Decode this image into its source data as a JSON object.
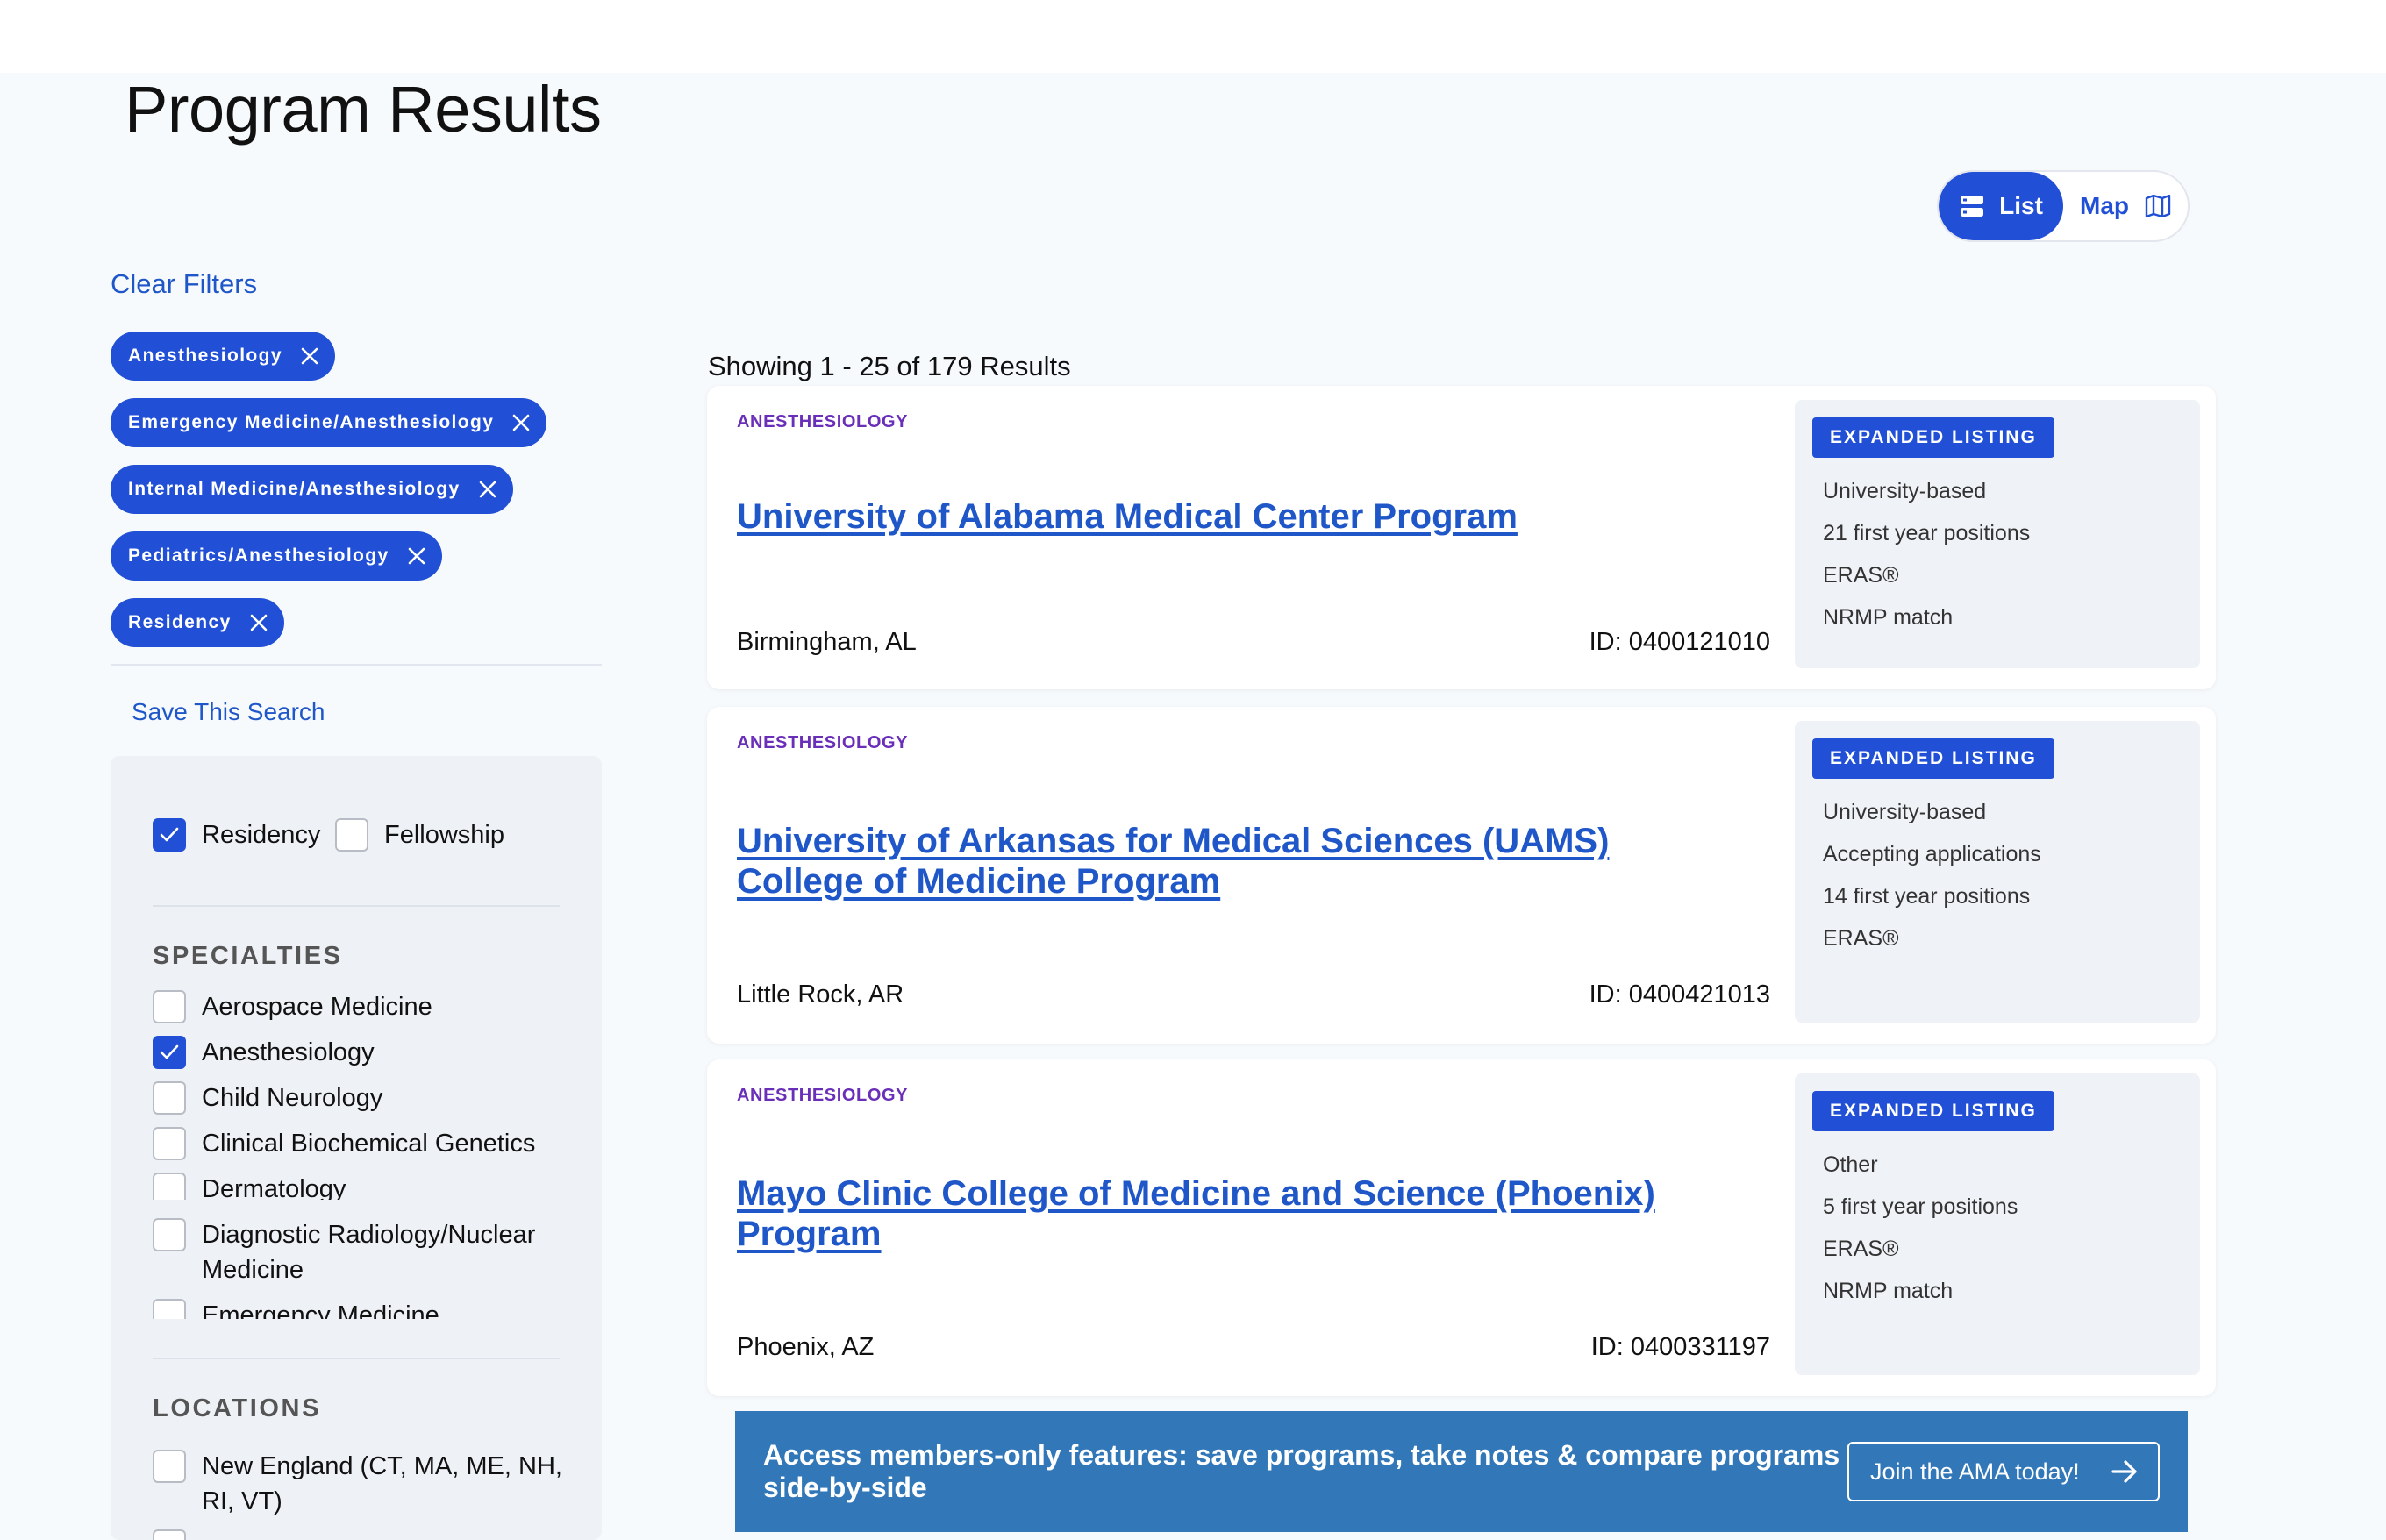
{
  "page": {
    "title": "Program Results"
  },
  "view_toggle": {
    "list_label": "List",
    "map_label": "Map"
  },
  "filters": {
    "clear_label": "Clear Filters",
    "chips": [
      {
        "label": "Anesthesiology"
      },
      {
        "label": "Emergency Medicine/Anesthesiology"
      },
      {
        "label": "Internal Medicine/Anesthesiology"
      },
      {
        "label": "Pediatrics/Anesthesiology"
      },
      {
        "label": "Residency"
      }
    ],
    "save_label": "Save This Search",
    "program_types": [
      {
        "label": "Residency",
        "checked": true
      },
      {
        "label": "Fellowship",
        "checked": false
      }
    ],
    "specialties_title": "SPECIALTIES",
    "specialties": [
      {
        "label": "Aerospace Medicine",
        "checked": false
      },
      {
        "label": "Anesthesiology",
        "checked": true
      },
      {
        "label": "Child Neurology",
        "checked": false
      },
      {
        "label": "Clinical Biochemical Genetics",
        "checked": false
      },
      {
        "label": "Dermatology",
        "checked": false
      },
      {
        "label": "Diagnostic Radiology/Nuclear Medicine",
        "checked": false
      },
      {
        "label": "Emergency Medicine",
        "checked": false
      }
    ],
    "locations_title": "LOCATIONS",
    "locations": [
      {
        "label": "New England (CT, MA, ME, NH, RI, VT)",
        "checked": false
      }
    ]
  },
  "results": {
    "count_text": "Showing 1 - 25 of 179 Results",
    "items": [
      {
        "specialty": "ANESTHESIOLOGY",
        "title": "University of Alabama Medical Center Program",
        "location": "Birmingham, AL",
        "id_text": "ID: 0400121010",
        "badge": "EXPANDED LISTING",
        "features": [
          "University-based",
          "21 first year positions",
          "ERAS®",
          "NRMP match"
        ]
      },
      {
        "specialty": "ANESTHESIOLOGY",
        "title": "University of Arkansas for Medical Sciences (UAMS) College of Medicine Program",
        "location": "Little Rock, AR",
        "id_text": "ID: 0400421013",
        "badge": "EXPANDED LISTING",
        "features": [
          "University-based",
          "Accepting applications",
          "14 first year positions",
          "ERAS®"
        ]
      },
      {
        "specialty": "ANESTHESIOLOGY",
        "title": "Mayo Clinic College of Medicine and Science (Phoenix) Program",
        "location": "Phoenix, AZ",
        "id_text": "ID: 0400331197",
        "badge": "EXPANDED LISTING",
        "features": [
          "Other",
          "5 first year positions",
          "ERAS®",
          "NRMP match"
        ]
      }
    ]
  },
  "banner": {
    "text": "Access members-only features: save programs, take notes & compare programs side-by-side",
    "button_label": "Join the AMA today!"
  },
  "colors": {
    "primary": "#2150d6",
    "link": "#1f57c8",
    "specialty": "#6a2fb8",
    "banner": "#3278b9"
  }
}
